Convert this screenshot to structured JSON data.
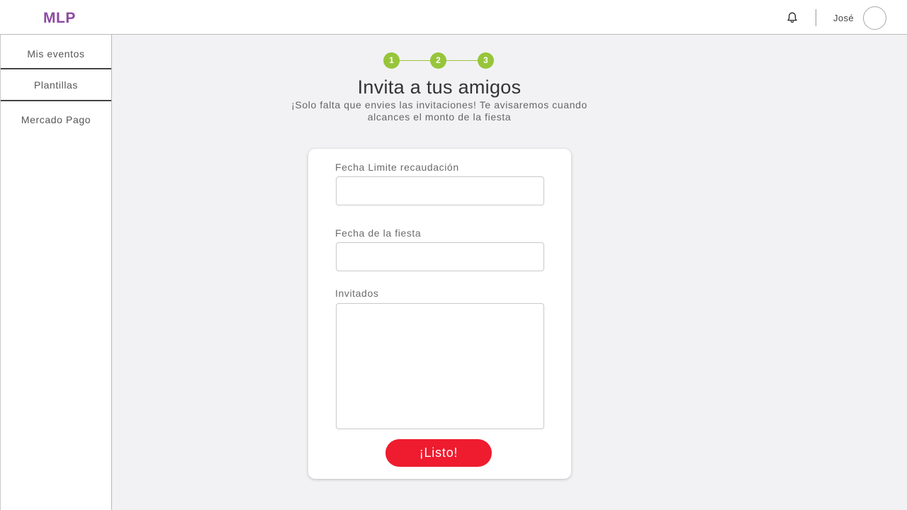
{
  "header": {
    "logo": "MLP",
    "username": "José",
    "bell_icon": "bell-icon"
  },
  "sidebar": {
    "items": [
      {
        "label": "Mis eventos"
      },
      {
        "label": "Plantillas"
      },
      {
        "label": "Mercado Pago"
      }
    ]
  },
  "stepper": {
    "steps": [
      "1",
      "2",
      "3"
    ],
    "current_step": 3,
    "accent_color": "#97c53a"
  },
  "main": {
    "title": "Invita a tus amigos",
    "subtitle": "¡Solo falta que envies las invitaciones! Te avisaremos cuando alcances el monto de la fiesta"
  },
  "form": {
    "deadline_label": "Fecha Limite recaudación",
    "deadline_value": "",
    "party_date_label": "Fecha de la fiesta",
    "party_date_value": "",
    "guests_label": "Invitados",
    "guests_value": "",
    "submit_label": "¡Listo!",
    "submit_color": "#ee1c2e"
  },
  "colors": {
    "brand": "#8e4aa3",
    "background": "#f2f2f4"
  }
}
